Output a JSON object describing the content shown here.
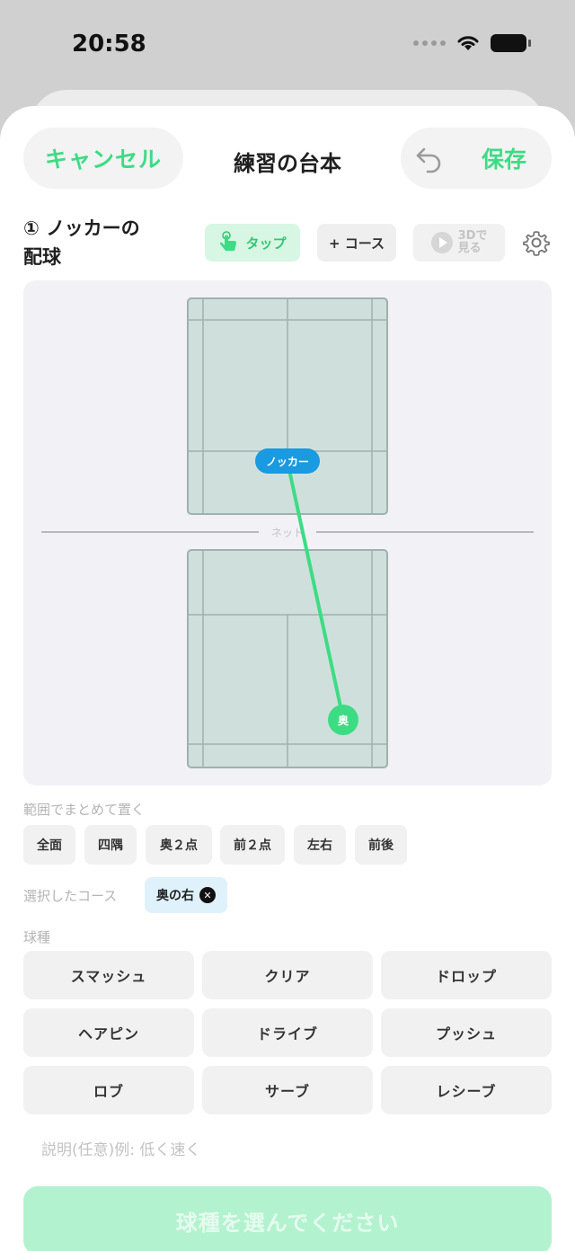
{
  "status_bar": {
    "time": "20:58"
  },
  "header": {
    "cancel_label": "キャンセル",
    "title": "練習の台本",
    "save_label": "保存"
  },
  "step": {
    "title_line1": "① ノッカーの",
    "title_line2": "配球"
  },
  "toolbar": {
    "tap_label": "タップ",
    "course_label": "+ コース",
    "view3d_line1": "3Dで",
    "view3d_line2": "見る"
  },
  "court": {
    "net_label": "ネット",
    "knocker_label": "ノッカー",
    "target_label": "奥"
  },
  "range_section": {
    "label": "範囲でまとめて置く",
    "options": [
      "全面",
      "四隅",
      "奥２点",
      "前２点",
      "左右",
      "前後"
    ]
  },
  "selected_course": {
    "label": "選択したコース",
    "chip_label": "奥の右"
  },
  "shot_types": {
    "label": "球種",
    "options": [
      "スマッシュ",
      "クリア",
      "ドロップ",
      "ヘアピン",
      "ドライブ",
      "プッシュ",
      "ロブ",
      "サーブ",
      "レシーブ"
    ]
  },
  "description": {
    "placeholder": "説明(任意)例: 低く速く"
  },
  "submit": {
    "label": "球種を選んでください"
  },
  "colors": {
    "accent_green": "#3ddc84",
    "court_fill": "#cfe0dc",
    "knocker_blue": "#1a9ae0",
    "selected_chip_bg": "#dff1fb"
  }
}
